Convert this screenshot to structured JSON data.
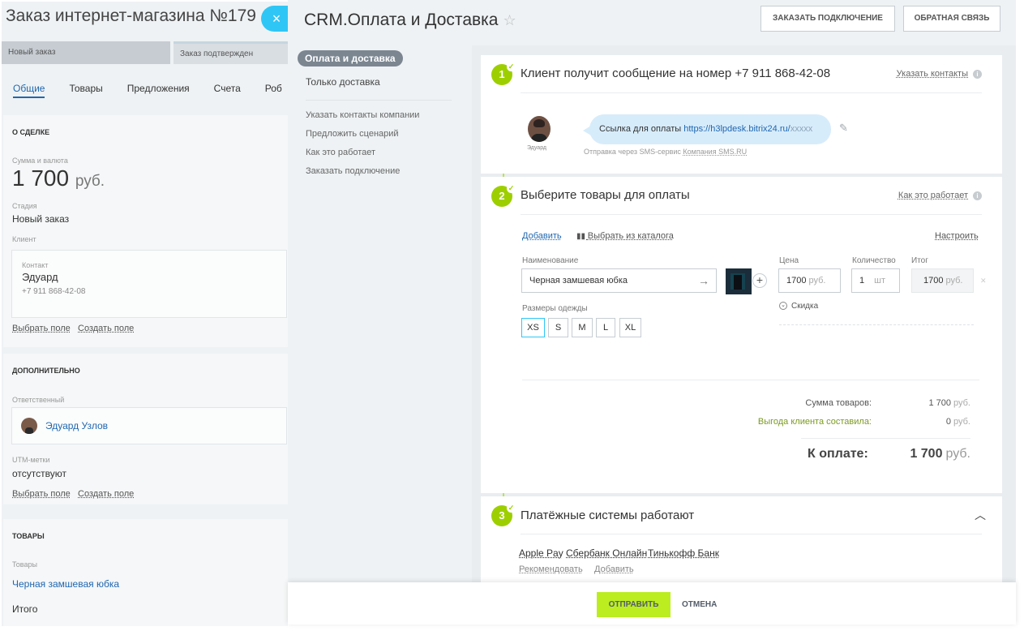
{
  "background": {
    "order_title": "Заказ интернет-магазина  №179",
    "close_symbol": "×",
    "stages": [
      "Новый заказ",
      "Заказ подтвержден"
    ],
    "tabs": [
      "Общие",
      "Товары",
      "Предложения",
      "Счета",
      "Роб"
    ],
    "deal": {
      "section": "О СДЕЛКЕ",
      "amount_label": "Сумма и валюта",
      "amount": "1 700",
      "currency": "руб.",
      "stage_label": "Стадия",
      "stage_value": "Новый заказ",
      "client_label": "Клиент",
      "contact_label": "Контакт",
      "contact_name": "Эдуард",
      "contact_phone": "+7 911 868-42-08",
      "select_field": "Выбрать поле",
      "create_field": "Создать поле"
    },
    "extra": {
      "section": "ДОПОЛНИТЕЛЬНО",
      "responsible_label": "Ответственный",
      "responsible_name": "Эдуард Узлов",
      "utm_label": "UTM-метки",
      "utm_value": "отсутствуют",
      "select_field": "Выбрать поле",
      "create_field": "Создать поле"
    },
    "goods": {
      "section": "ТОВАРЫ",
      "goods_label": "Товары",
      "goods_item": "Черная замшевая юбка",
      "total_label": "Итого"
    }
  },
  "slider": {
    "title": "CRM.Оплата и Доставка",
    "star": "☆",
    "btn_connect": "ЗАКАЗАТЬ ПОДКЛЮЧЕНИЕ",
    "btn_feedback": "ОБРАТНАЯ СВЯЗЬ",
    "menu": {
      "active": "Оплата и доставка",
      "second": "Только доставка",
      "sub": [
        "Указать контакты компании",
        "Предложить сценарий",
        "Как это работает",
        "Заказать подключение"
      ]
    },
    "step1": {
      "num": "1",
      "title": "Клиент получит сообщение на номер +7 911 868-42-08",
      "link": "Указать контакты",
      "avatar_name": "Эдуард",
      "msg_prefix": "Ссылка для оплаты ",
      "msg_url": "https://h3lpdesk.bitrix24.ru/",
      "msg_mask": "xxxxx",
      "via_prefix": "Отправка через SMS-сервис ",
      "via_service": "Компания SMS.RU"
    },
    "step2": {
      "num": "2",
      "title": "Выберите товары для оплаты",
      "link": "Как это работает",
      "add": "Добавить",
      "catalog": "Выбрать из каталога",
      "configure": "Настроить",
      "name_label": "Наименование",
      "name_value": "Черная замшевая юбка",
      "price_label": "Цена",
      "price_value": "1700",
      "price_unit": "руб.",
      "qty_label": "Количество",
      "qty_value": "1",
      "qty_unit": "шт",
      "total_label": "Итог",
      "total_value": "1700",
      "total_unit": "руб.",
      "sizes_label": "Размеры одежды",
      "sizes": [
        "XS",
        "S",
        "M",
        "L",
        "XL"
      ],
      "discount": "Скидка",
      "sum_label": "Сумма товаров:",
      "sum_value": "1 700",
      "benefit_label": "Выгода клиента составила:",
      "benefit_value": "0",
      "currency": "руб.",
      "pay_label": "К оплате:",
      "pay_value": "1 700"
    },
    "step3": {
      "num": "3",
      "title": "Платёжные системы работают",
      "systems": [
        "Apple Pay",
        "Сбербанк Онлайн",
        "Тинькофф Банк"
      ],
      "recommend": "Рекомендовать",
      "add": "Добавить"
    },
    "footer": {
      "send": "ОТПРАВИТЬ",
      "cancel": "ОТМЕНА"
    }
  },
  "colors": {
    "accent_green": "#9dcf00",
    "send_button": "#bbed21",
    "link_blue": "#2067b0",
    "close_blue": "#2fc6f6"
  }
}
